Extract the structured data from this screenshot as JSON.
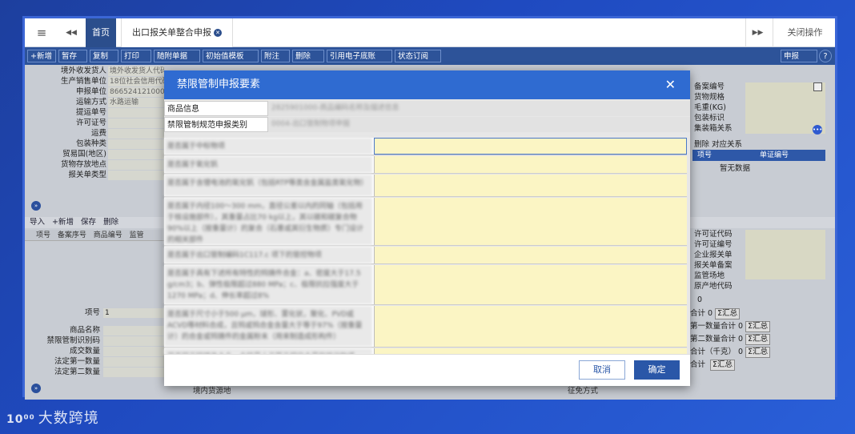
{
  "topbar": {
    "menu_icon": "≡",
    "back_icon": "◀◀",
    "home": "首页",
    "tab": "出口报关单整合申报",
    "next_icon": "▶▶",
    "close_ops": "关闭操作"
  },
  "toolbar": {
    "items": [
      "+新增",
      "暂存",
      "复制",
      "打印",
      "随附单据",
      "初始值模板",
      "附注",
      "删除",
      "引用电子底账",
      "状态订阅"
    ],
    "declare": "申报",
    "help": "?"
  },
  "left_form": [
    {
      "label": "境外收发货人",
      "value": "境外收发货人代码"
    },
    {
      "label": "生产销售单位",
      "value": "18位社会信用代码"
    },
    {
      "label": "申报单位",
      "value": "8665241210000"
    },
    {
      "label": "运输方式",
      "value": "水路运输"
    },
    {
      "label": "提运单号",
      "value": ""
    },
    {
      "label": "许可证号",
      "value": ""
    },
    {
      "label": "运费",
      "value": ""
    },
    {
      "label": "包装种类",
      "value": ""
    },
    {
      "label": "贸易国(地区)",
      "value": ""
    },
    {
      "label": "货物存放地点",
      "value": ""
    },
    {
      "label": "报关单类型",
      "value": ""
    }
  ],
  "goods_bar": {
    "items": [
      "导入",
      "+新增",
      "保存",
      "删除"
    ]
  },
  "goods_head": [
    "项号",
    "备案序号",
    "商品编号",
    "监管"
  ],
  "lower_form": {
    "item_no_label": "项号",
    "item_no": "1",
    "labels": [
      "商品名称",
      "禁限管制识别码",
      "成交数量",
      "法定第一数量",
      "法定第二数量"
    ],
    "bottom_label": "境内货源地",
    "bottom_right": "征免方式"
  },
  "right_panel": {
    "top_labels": [
      "备案编号",
      "货物规格",
      "毛重(KG)",
      "包装标识",
      "集装箱关系"
    ],
    "rel_buttons": [
      "删除",
      "对应关系"
    ],
    "rel_head": [
      "项号",
      "单证编号"
    ],
    "rel_empty": "暂无数据",
    "mid_labels": [
      "许可证代码",
      "许可证编号",
      "企业报关单",
      "报关单备案",
      "监管场地",
      "原产地代码"
    ],
    "zero": "0",
    "sums": [
      {
        "label": "数量合计",
        "value": "0",
        "btn": "Σ汇总"
      },
      {
        "label": "法定第一数量合计",
        "value": "0",
        "btn": "Σ汇总"
      },
      {
        "label": "法定第二数量合计",
        "value": "0",
        "btn": "Σ汇总"
      },
      {
        "label": "总价合计（千克）",
        "value": "0",
        "btn": "Σ汇总"
      },
      {
        "label": "件数合计",
        "value": "",
        "btn": "Σ汇总"
      }
    ]
  },
  "modal": {
    "title": "禁限管制申报要素",
    "close_icon": "✕",
    "info": [
      {
        "key": "商品信息",
        "value": "2825901000-商品编码名称及描述信息"
      },
      {
        "key": "禁限管制规范申报类别",
        "value": "0004-出口管制物项申报"
      }
    ],
    "elements": [
      "是否属于中标物项",
      "是否属于氧化钒",
      "是否属于含锂电池的氧化钒（包括RTP等类含金属盐类氧化物）",
      "是否属于内径100～300 mm，直径公差以内的同轴（包括用于核设施部件），其重量占比70 kg以上，其以碳和碳复合物90%以上（按重量计）的复合（石墨或其衍生物质）专门设计的相关部件",
      "是否属于出口管制编码1C117.c 项下的管控物项",
      "是否属于具有下述所有特性的钨铸件合金：a、密度大于17.5 g/cm3；b、弹性极限超过880 MPa；c、极限抗拉强度大于1270 MPa；d、伸长率超过8%",
      "是否属于尺寸小于500 μm，球形、雾化状，聚化、PVD或ACVD等材料合成，且钨或钨合金含量大于等于97%（按重量计）的合金或钨铸件的金属粉末（用来制造成形构件）",
      "是否属于钨铸件合金，含钨量大于等于规定含量的其他物项"
    ],
    "cancel": "取消",
    "ok": "确定"
  },
  "brand": {
    "mark": "10⁰⁰",
    "text": "大数跨境"
  }
}
